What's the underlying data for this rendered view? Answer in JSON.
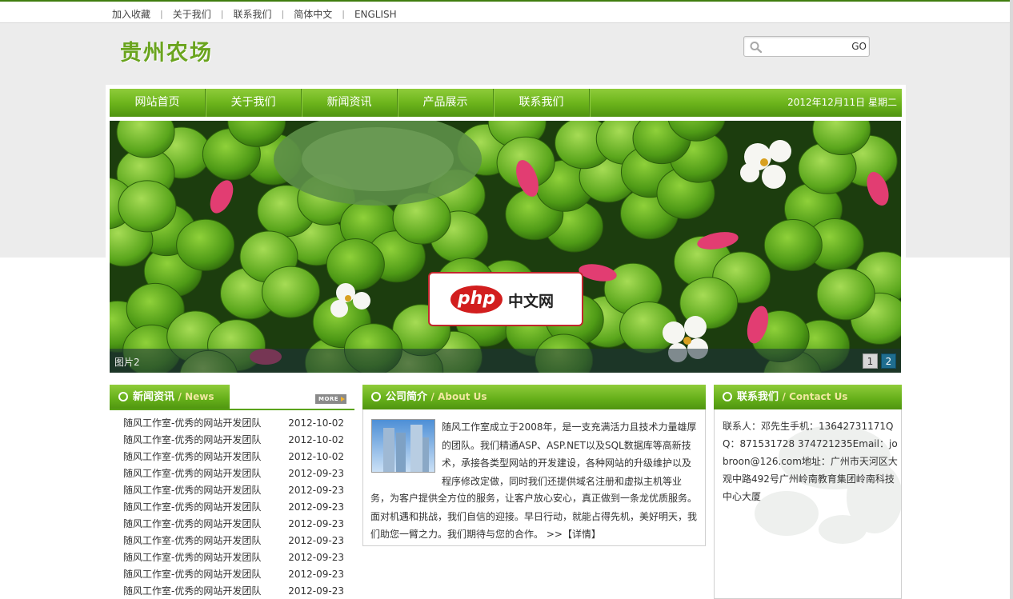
{
  "topbar": {
    "links": [
      "加入收藏",
      "关于我们",
      "联系我们",
      "简体中文",
      "ENGLISH"
    ]
  },
  "header": {
    "logo_text": "贵州农场",
    "search": {
      "placeholder": "",
      "value": "",
      "button": "GO"
    }
  },
  "nav": {
    "items": [
      "网站首页",
      "关于我们",
      "新闻资讯",
      "产品展示",
      "联系我们"
    ],
    "date": "2012年12月11日  星期二"
  },
  "banner": {
    "caption": "图片2",
    "pages": [
      "1",
      "2"
    ],
    "active_page": 2,
    "watermark": {
      "brand": "php",
      "text": "中文网"
    }
  },
  "news": {
    "title_cn": "新闻资讯",
    "title_en": "/ News",
    "more_label": "MORE",
    "items": [
      {
        "title": "随风工作室-优秀的网站开发团队",
        "date": "2012-10-02"
      },
      {
        "title": "随风工作室-优秀的网站开发团队",
        "date": "2012-10-02"
      },
      {
        "title": "随风工作室-优秀的网站开发团队",
        "date": "2012-10-02"
      },
      {
        "title": "随风工作室-优秀的网站开发团队",
        "date": "2012-09-23"
      },
      {
        "title": "随风工作室-优秀的网站开发团队",
        "date": "2012-09-23"
      },
      {
        "title": "随风工作室-优秀的网站开发团队",
        "date": "2012-09-23"
      },
      {
        "title": "随风工作室-优秀的网站开发团队",
        "date": "2012-09-23"
      },
      {
        "title": "随风工作室-优秀的网站开发团队",
        "date": "2012-09-23"
      },
      {
        "title": "随风工作室-优秀的网站开发团队",
        "date": "2012-09-23"
      },
      {
        "title": "随风工作室-优秀的网站开发团队",
        "date": "2012-09-23"
      },
      {
        "title": "随风工作室-优秀的网站开发团队",
        "date": "2012-09-23"
      }
    ]
  },
  "about": {
    "title_cn": "公司简介",
    "title_en": "/ About Us",
    "text_part1": "随风工作室成立于2008年，是一支充满活力且技术力量雄厚的团队。我们精通ASP、ASP.NET以及SQL数据库等高新技术，承接各类型网站的开发建设，各种网站的升级维护以及程序修改定做，同时我们还提供域名注册和虚拟主机等业",
    "text_part2": "务，为客户提供全方位的服务，让客户放心安心，真正做到一条龙优质服务。面对机遇和挑战，我们自信的迎接。早日行动，就能占得先机，美好明天，我们助您一臂之力。我们期待与您的合作。",
    "detail_label": ">>【详情】"
  },
  "contact": {
    "title_cn": "联系我们",
    "title_en": "/ Contact Us",
    "text": "联系人：邓先生手机：13642731171Q Q：871531728 374721235Email：jobroon@126.com地址：广州市天河区大观中路492号广州岭南教育集团岭南科技中心大厦"
  },
  "colors": {
    "brand_green": "#6aa41e",
    "nav_green": "#6db51c",
    "pager_active": "#1f6d8f"
  }
}
